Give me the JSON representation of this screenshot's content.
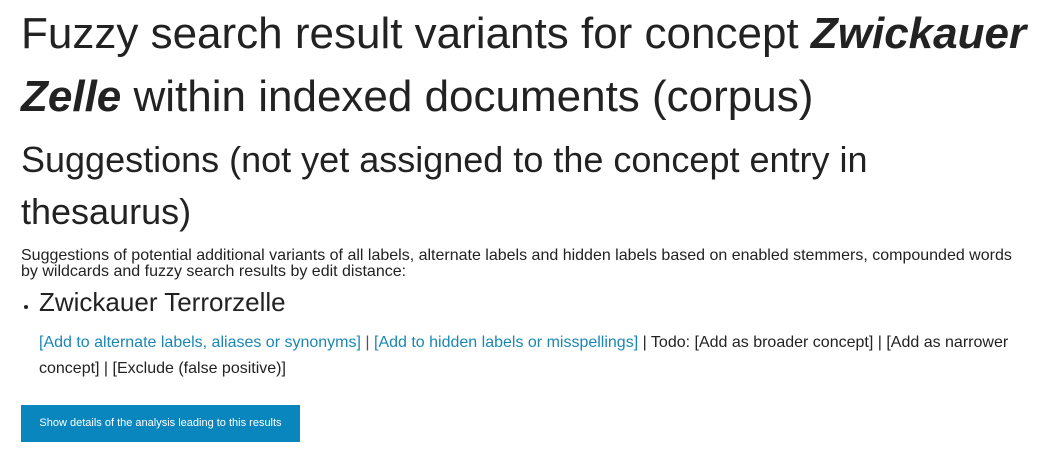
{
  "header": {
    "title_prefix": "Fuzzy search result variants for concept ",
    "concept_name": "Zwickauer Zelle",
    "title_suffix": " within indexed documents (corpus)"
  },
  "suggestions_section": {
    "heading": "Suggestions (not yet assigned to the concept entry in thesaurus)",
    "description": "Suggestions of potential additional variants of all labels, alternate labels and hidden labels based on enabled stemmers, compounded words by wildcards and fuzzy search results by edit distance:",
    "items": [
      {
        "term": "Zwickauer Terrorzelle",
        "actions": {
          "add_alternate": "[Add to alternate labels, aliases or synonyms]",
          "separator": " | ",
          "add_hidden": "[Add to hidden labels or misspellings]",
          "todo_text": " | Todo: [Add as broader concept] | [Add as narrower concept] | [Exclude (false positive)]"
        }
      }
    ]
  },
  "details_button": {
    "label": "Show details of the analysis leading to this results"
  },
  "colors": {
    "link": "#1a87b5",
    "button_bg": "#0a86bf",
    "text": "#222222"
  }
}
